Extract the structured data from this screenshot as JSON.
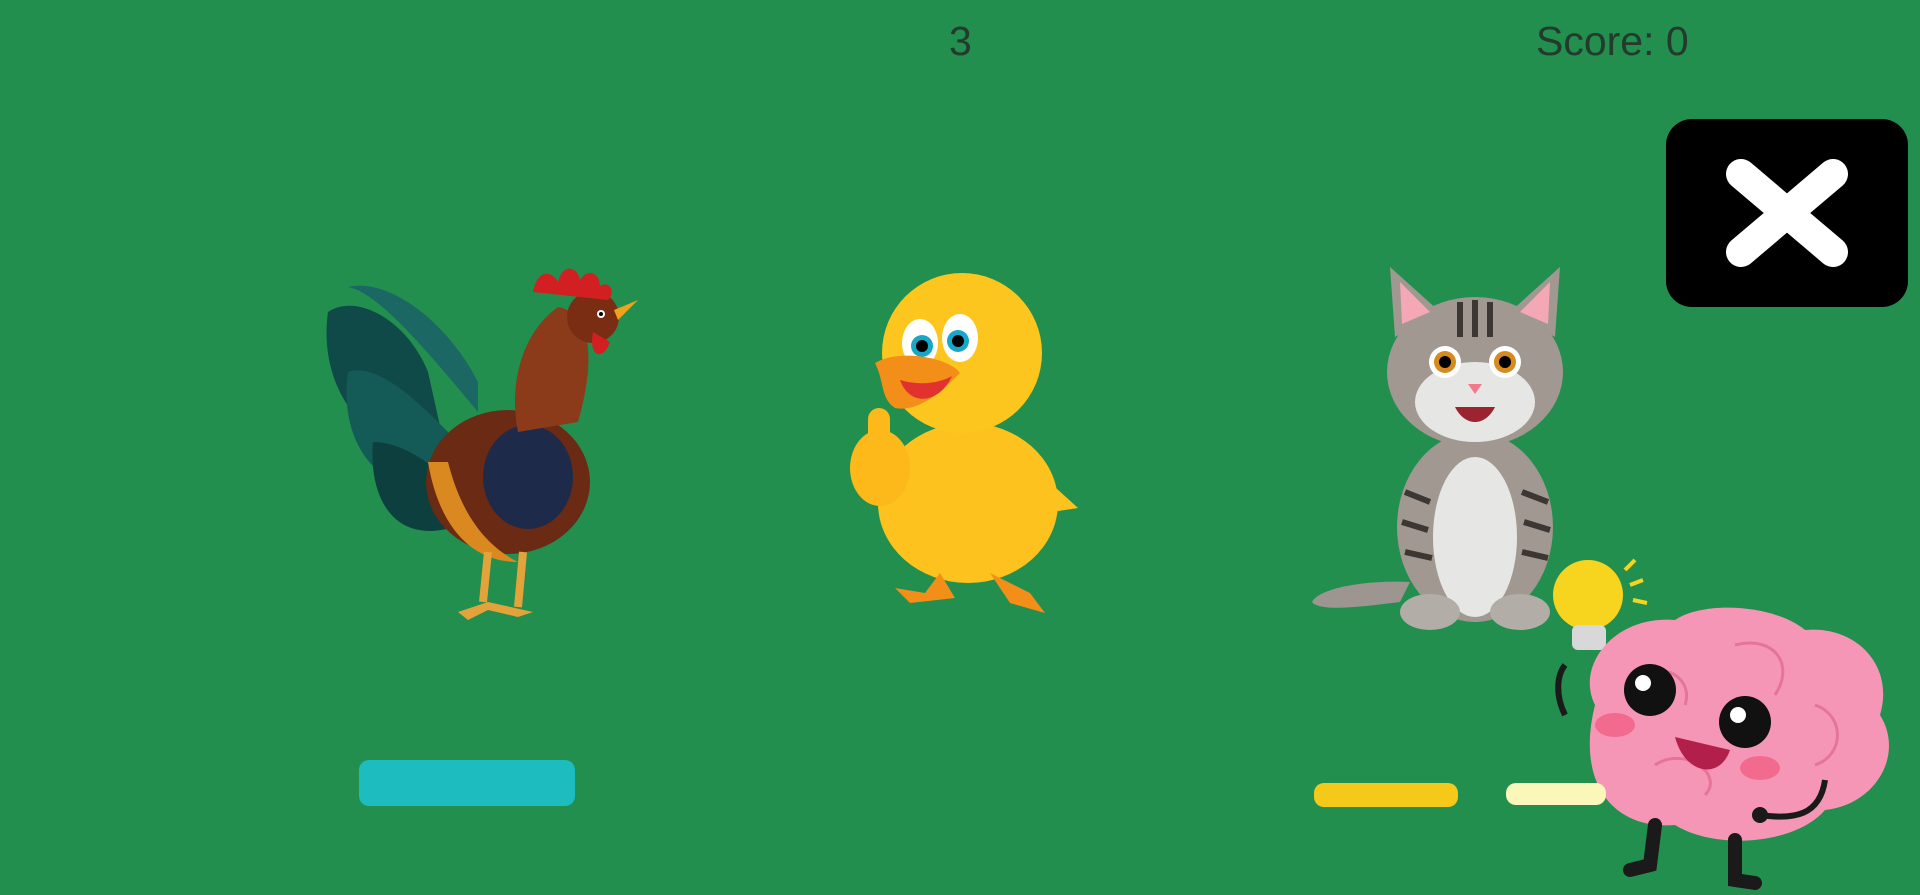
{
  "hud": {
    "round": "3",
    "score": "Score: 0"
  },
  "close_button": {
    "icon": "close-icon"
  },
  "animals": [
    {
      "name": "rooster",
      "icon": "rooster-illustration"
    },
    {
      "name": "duck",
      "icon": "duck-thumbs-up-illustration"
    },
    {
      "name": "cat",
      "icon": "cat-sitting-illustration"
    }
  ],
  "mascot": {
    "icon": "brain-mascot-with-lightbulb"
  },
  "answer_bars": [
    {
      "slot": "left",
      "color": "#1cbcbf"
    },
    {
      "slot": "right-1",
      "color": "#f5c919"
    },
    {
      "slot": "right-2",
      "color": "#fbf6b9"
    }
  ],
  "colors": {
    "background": "#228f4f",
    "hud_text": "#233a2c",
    "close_bg": "#000000"
  }
}
